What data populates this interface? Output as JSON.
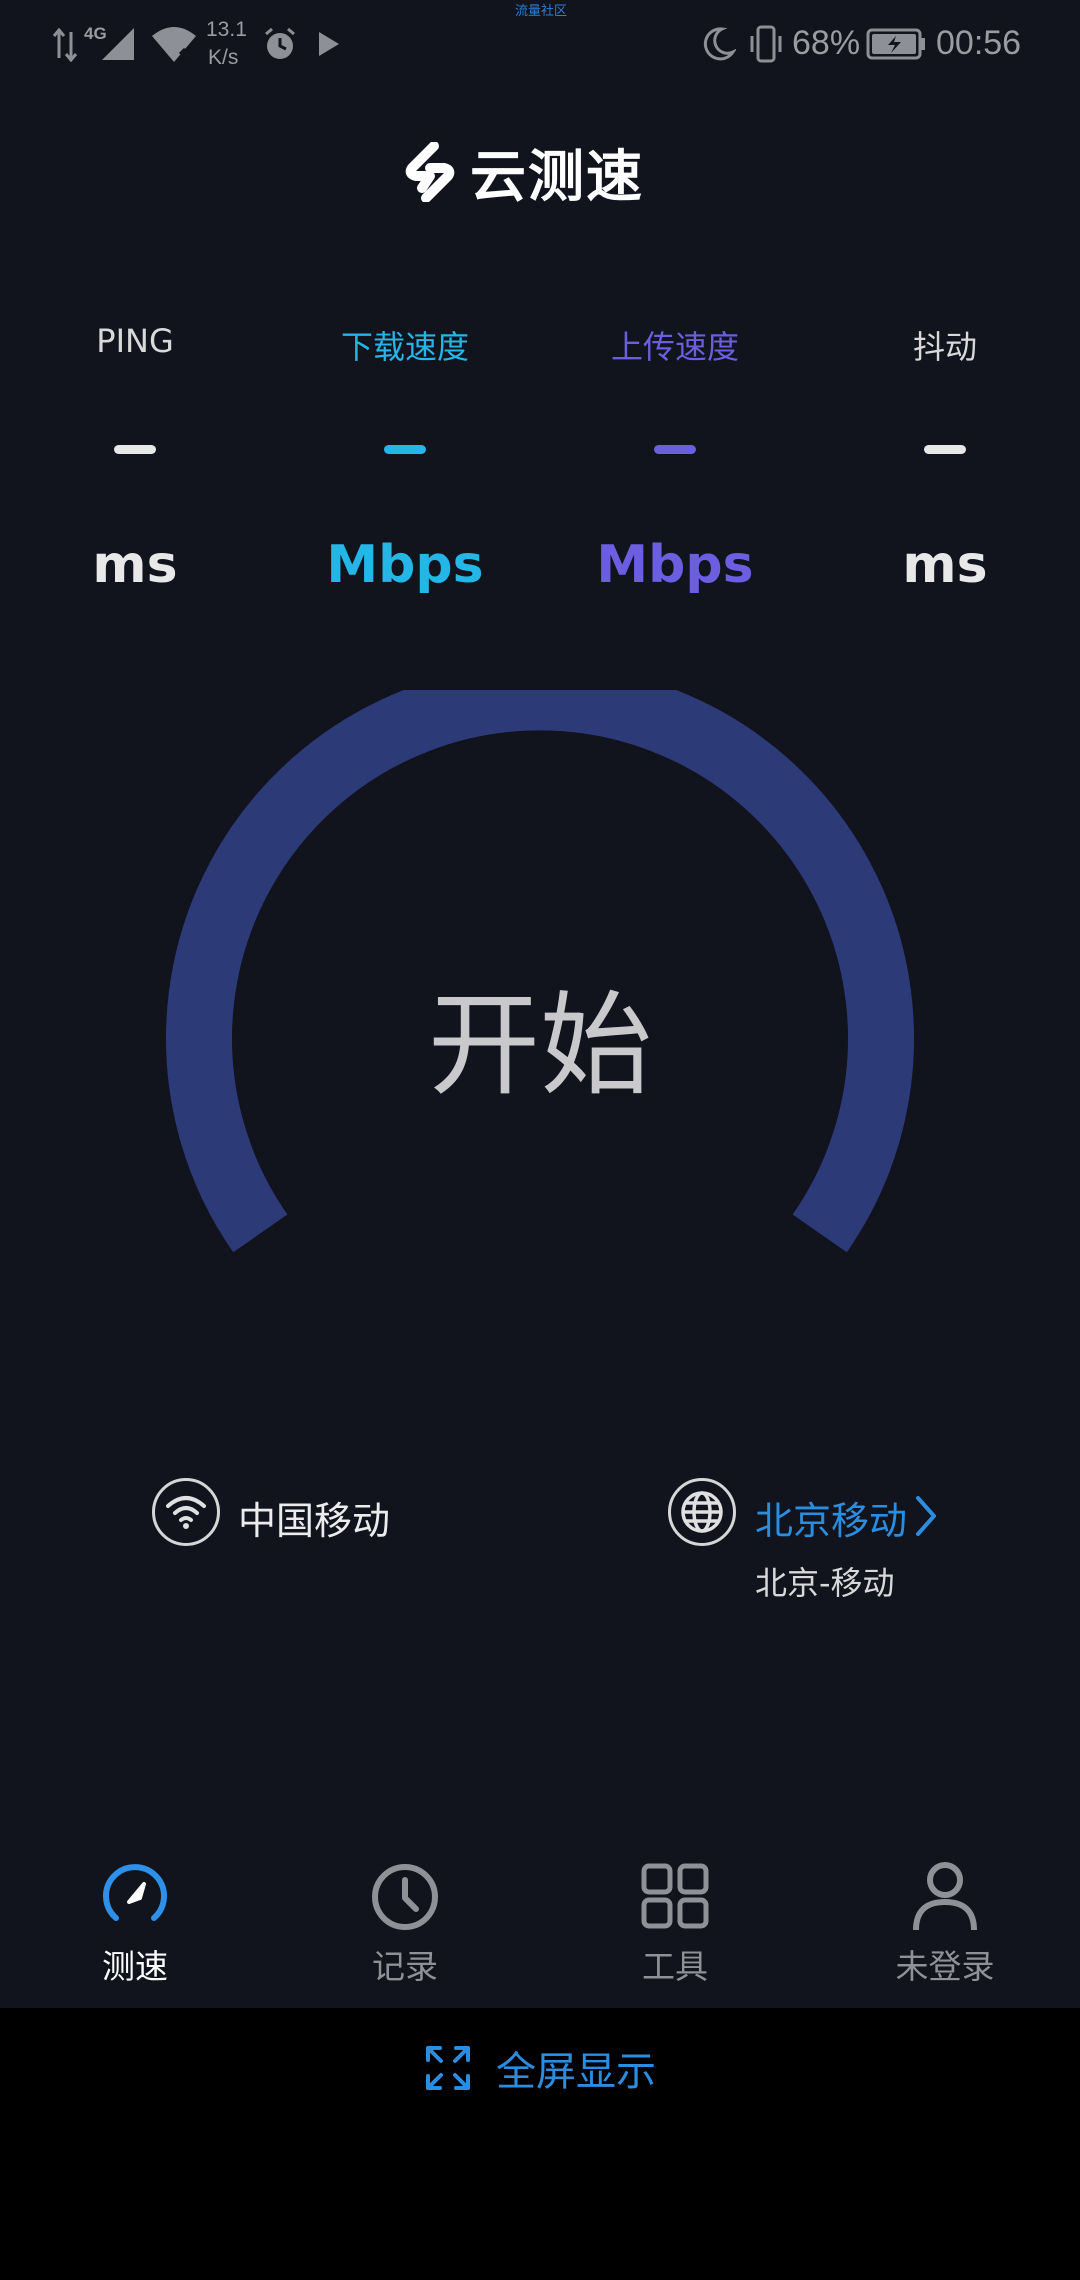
{
  "status_bar": {
    "net_type": "4G",
    "speed_value": "13.1",
    "speed_unit": "K/s",
    "top_tiny_text": "流量社区",
    "battery": "68%",
    "time": "00:56"
  },
  "app": {
    "title": "云测速"
  },
  "metrics": [
    {
      "label": "PING",
      "unit": "ms",
      "color": "#e8e8e8",
      "label_color": "#d9d9d9"
    },
    {
      "label": "下载速度",
      "unit": "Mbps",
      "color": "#23b6e6",
      "label_color": "#23b6e6"
    },
    {
      "label": "上传速度",
      "unit": "Mbps",
      "color": "#6c5ee0",
      "label_color": "#6c5ee0"
    },
    {
      "label": "抖动",
      "unit": "ms",
      "color": "#e8e8e8",
      "label_color": "#d9d9d9"
    }
  ],
  "gauge": {
    "start_label": "开始",
    "arc_color": "#2d3a78"
  },
  "network": {
    "carrier": "中国移动",
    "server_name": "北京移动",
    "server_location": "北京-移动",
    "server_color": "#2b8de0"
  },
  "nav": [
    {
      "label": "测速",
      "icon": "speedometer-icon",
      "active": true
    },
    {
      "label": "记录",
      "icon": "clock-icon",
      "active": false
    },
    {
      "label": "工具",
      "icon": "grid-icon",
      "active": false
    },
    {
      "label": "未登录",
      "icon": "user-icon",
      "active": false
    }
  ],
  "fullscreen": {
    "label": "全屏显示",
    "icon": "expand-icon"
  }
}
